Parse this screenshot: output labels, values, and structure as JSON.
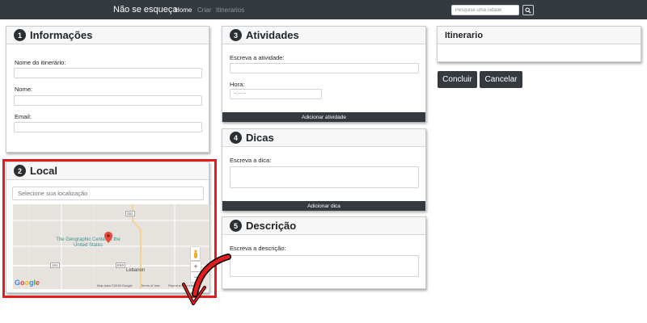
{
  "navbar": {
    "brand": "Não se esqueça",
    "links": [
      "Home",
      "Criar",
      "Itinerarios"
    ],
    "search_placeholder": "Pesquise uma cidade",
    "search_icon": "search-icon"
  },
  "informacoes": {
    "number": "1",
    "title": "Informações",
    "fields": [
      "Nome do itinerário:",
      "Nome:",
      "Email:"
    ]
  },
  "local": {
    "number": "2",
    "title": "Local",
    "search_placeholder": "Selecione sua localização",
    "map": {
      "place_label": "The Geographic Center of the United States",
      "town_label": "Lebanon",
      "road_labels": [
        "281",
        "191",
        "E60"
      ],
      "zoom_in": "+",
      "zoom_out": "−",
      "logo": "Google",
      "footer": [
        "Map data ©2018 Google",
        "Terms of Use",
        "Report a map error"
      ]
    }
  },
  "atividades": {
    "number": "3",
    "title": "Atividades",
    "activity_label": "Escreva a atividade:",
    "time_label": "Hora:",
    "time_placeholder": "--:-- --",
    "add_button": "Adicionar atividade"
  },
  "dicas": {
    "number": "4",
    "title": "Dicas",
    "label": "Escreva a dica:",
    "add_button": "Adicionar dica"
  },
  "descricao": {
    "number": "5",
    "title": "Descrição",
    "label": "Escreva a descrição:"
  },
  "itinerario": {
    "title": "Itinerario"
  },
  "actions": {
    "confirm": "Concluir",
    "cancel": "Cancelar"
  },
  "colors": {
    "navbar": "#343a40",
    "highlight_border": "#e61c1c",
    "arrow": "#e61c1c",
    "map_pin": "#e64c3c"
  }
}
